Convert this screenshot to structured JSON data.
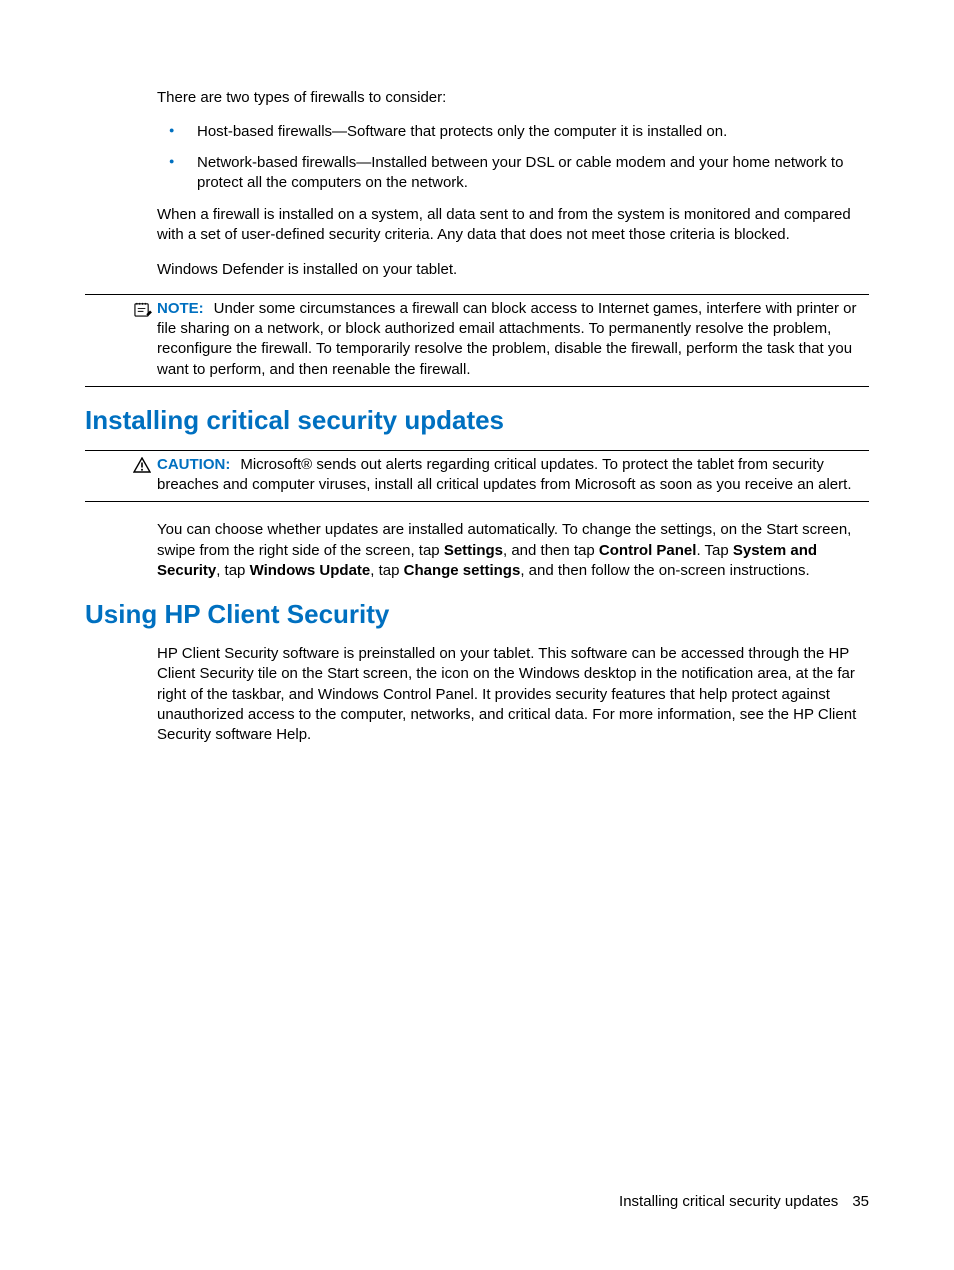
{
  "intro": {
    "p1": "There are two types of firewalls to consider:",
    "bullets": [
      "Host-based firewalls—Software that protects only the computer it is installed on.",
      "Network-based firewalls—Installed between your DSL or cable modem and your home network to protect all the computers on the network."
    ],
    "p2": "When a firewall is installed on a system, all data sent to and from the system is monitored and compared with a set of user-defined security criteria. Any data that does not meet those criteria is blocked.",
    "p3": "Windows Defender is installed on your tablet."
  },
  "note": {
    "label": "NOTE:",
    "text": "Under some circumstances a firewall can block access to Internet games, interfere with printer or file sharing on a network, or block authorized email attachments. To permanently resolve the problem, reconfigure the firewall. To temporarily resolve the problem, disable the firewall, perform the task that you want to perform, and then reenable the firewall."
  },
  "section1": {
    "title": "Installing critical security updates",
    "caution": {
      "label": "CAUTION:",
      "text": "Microsoft® sends out alerts regarding critical updates. To protect the tablet from security breaches and computer viruses, install all critical updates from Microsoft as soon as you receive an alert."
    },
    "p1_a": "You can choose whether updates are installed automatically. To change the settings, on the Start screen, swipe from the right side of the screen, tap ",
    "p1_b1": "Settings",
    "p1_c": ", and then tap ",
    "p1_b2": "Control Panel",
    "p1_d": ". Tap ",
    "p1_b3": "System and Security",
    "p1_e": ", tap ",
    "p1_b4": "Windows Update",
    "p1_f": ", tap ",
    "p1_b5": "Change settings",
    "p1_g": ", and then follow the on-screen instructions."
  },
  "section2": {
    "title": "Using HP Client Security",
    "p1": "HP Client Security software is preinstalled on your tablet. This software can be accessed through the HP Client Security tile on the Start screen, the icon on the Windows desktop in the notification area, at the far right of the taskbar, and Windows Control Panel. It provides security features that help protect against unauthorized access to the computer, networks, and critical data. For more information, see the HP Client Security software Help."
  },
  "footer": {
    "label": "Installing critical security updates",
    "page": "35"
  }
}
